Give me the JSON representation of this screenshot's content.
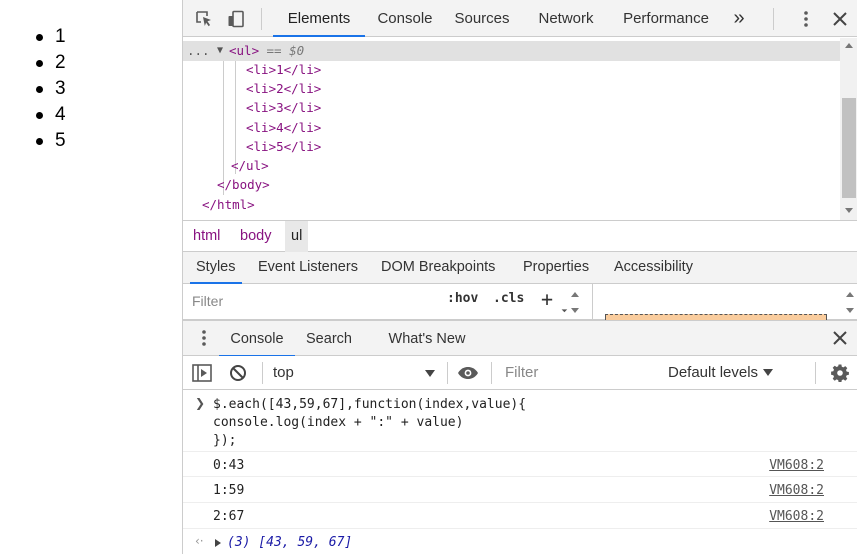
{
  "page": {
    "list_items": [
      "1",
      "2",
      "3",
      "4",
      "5"
    ]
  },
  "devtools": {
    "main_tabs": [
      "Elements",
      "Console",
      "Sources",
      "Network",
      "Performance"
    ],
    "active_main_tab": "Elements",
    "overflow_label": "»",
    "elements": {
      "selected_node": "<ul>",
      "selected_suffix": " == $0",
      "child_lines": [
        "<li>1</li>",
        "<li>2</li>",
        "<li>3</li>",
        "<li>4</li>",
        "<li>5</li>"
      ],
      "close_ul": "</ul>",
      "close_body": "</body>",
      "close_html": "</html>",
      "ellipsis": "..."
    },
    "breadcrumbs": [
      "html",
      "body",
      "ul"
    ],
    "styles_tabs": [
      "Styles",
      "Event Listeners",
      "DOM Breakpoints",
      "Properties",
      "Accessibility"
    ],
    "styles_filter_placeholder": "Filter",
    "hov_label": ":hov",
    "cls_label": ".cls",
    "add_label": "+",
    "drawer_tabs": [
      "Console",
      "Search",
      "What's New"
    ],
    "console_toolbar": {
      "context": "top",
      "filter_placeholder": "Filter",
      "levels": "Default levels"
    },
    "console": {
      "input_lines": [
        "$.each([43,59,67],function(index,value){",
        "console.log(index + \":\" + value)",
        "});"
      ],
      "logs": [
        {
          "text": "0:43",
          "source": "VM608:2"
        },
        {
          "text": "1:59",
          "source": "VM608:2"
        },
        {
          "text": "2:67",
          "source": "VM608:2"
        }
      ],
      "result": "(3) [43, 59, 67]"
    }
  },
  "colors": {
    "accent": "#1a73e8",
    "tag": "#881280",
    "number": "#1a1aa6",
    "string": "#c41a16"
  }
}
